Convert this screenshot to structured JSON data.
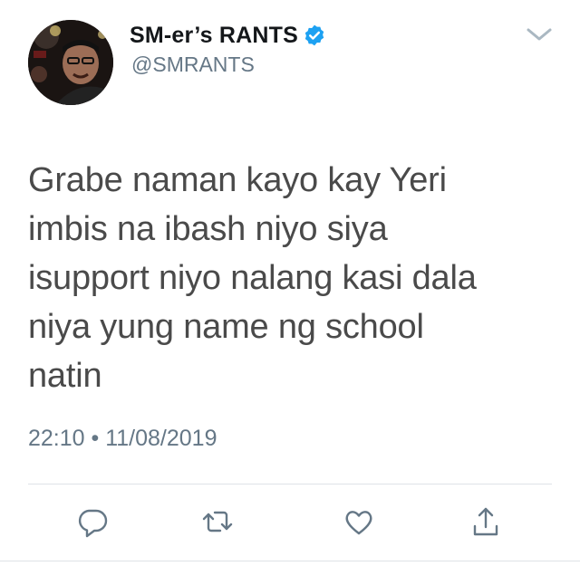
{
  "tweet": {
    "display_name": "SM-er’s RANTS",
    "handle": "@SMRANTS",
    "verified": true,
    "text_lines": [
      "Grabe naman kayo kay Yeri",
      "imbis na ibash niyo siya",
      "isupport niyo nalang kasi dala",
      "niya yung name ng school",
      "natin"
    ],
    "timestamp": "22:10 • 11/08/2019"
  },
  "icons": {
    "verified": "verified-badge-icon",
    "caret": "chevron-down-icon",
    "reply": "reply-icon",
    "retweet": "retweet-icon",
    "like": "heart-icon",
    "share": "share-icon"
  },
  "colors": {
    "text": "#4a4a4a",
    "name": "#14171a",
    "secondary": "#657786",
    "verified_blue": "#1da1f2",
    "divider": "#dfe3e7"
  }
}
